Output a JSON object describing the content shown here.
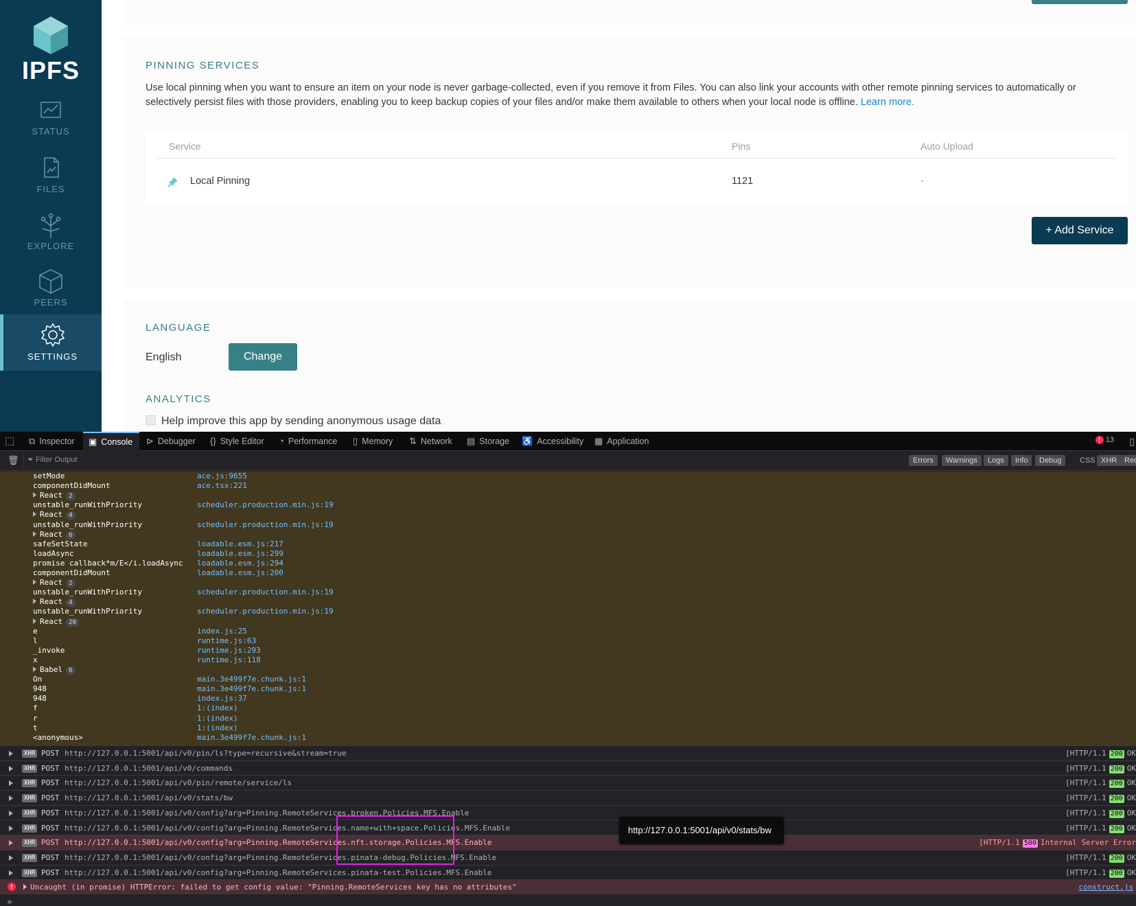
{
  "app": {
    "logo_text": "IPFS",
    "nav": [
      {
        "label": "STATUS",
        "icon": "status-chart-icon"
      },
      {
        "label": "FILES",
        "icon": "files-document-icon"
      },
      {
        "label": "EXPLORE",
        "icon": "explore-tree-icon"
      },
      {
        "label": "PEERS",
        "icon": "peers-cube-icon"
      },
      {
        "label": "SETTINGS",
        "icon": "settings-gear-icon",
        "active": true
      }
    ],
    "pinning": {
      "title": "PINNING SERVICES",
      "description": "Use local pinning when you want to ensure an item on your node is never garbage-collected, even if you remove it from Files. You can also link your accounts with other remote pinning services to automatically or selectively persist files with those providers, enabling you to keep backup copies of your files and/or make them available to others when your local node is offline.",
      "learn_more": "Learn more.",
      "columns": [
        "Service",
        "Pins",
        "Auto Upload"
      ],
      "rows": [
        {
          "service": "Local Pinning",
          "pins": "1121",
          "auto_upload": "-"
        }
      ],
      "add_button": "+ Add Service"
    },
    "language": {
      "title": "LANGUAGE",
      "value": "English",
      "change_button": "Change"
    },
    "analytics": {
      "title": "ANALYTICS",
      "checkbox_label": "Help improve this app by sending anonymous usage data"
    }
  },
  "devtools": {
    "tabs": [
      "Inspector",
      "Console",
      "Debugger",
      "Style Editor",
      "Performance",
      "Memory",
      "Network",
      "Storage",
      "Accessibility",
      "Application"
    ],
    "selected_tab": "Console",
    "error_count": "13",
    "filter_placeholder": "Filter Output",
    "filter_buttons": [
      "Errors",
      "Warnings",
      "Logs",
      "Info",
      "Debug",
      "CSS",
      "XHR",
      "Req"
    ],
    "stack": [
      {
        "fn": "setMode",
        "loc": "ace.js:9655"
      },
      {
        "fn": "componentDidMount",
        "loc": "ace.tsx:221"
      },
      {
        "group": "React",
        "count": "2"
      },
      {
        "fn": "unstable_runWithPriority",
        "loc": "scheduler.production.min.js:19"
      },
      {
        "group": "React",
        "count": "4"
      },
      {
        "fn": "unstable_runWithPriority",
        "loc": "scheduler.production.min.js:19"
      },
      {
        "group": "React",
        "count": "6"
      },
      {
        "fn": "safeSetState",
        "loc": "loadable.esm.js:217"
      },
      {
        "fn": "loadAsync",
        "loc": "loadable.esm.js:299"
      },
      {
        "fn": "promise callback*m/E</i.loadAsync",
        "loc": "loadable.esm.js:294"
      },
      {
        "fn": "componentDidMount",
        "loc": "loadable.esm.js:200"
      },
      {
        "group": "React",
        "count": "2"
      },
      {
        "fn": "unstable_runWithPriority",
        "loc": "scheduler.production.min.js:19"
      },
      {
        "group": "React",
        "count": "4"
      },
      {
        "fn": "unstable_runWithPriority",
        "loc": "scheduler.production.min.js:19"
      },
      {
        "group": "React",
        "count": "20"
      },
      {
        "fn": "e",
        "loc": "index.js:25"
      },
      {
        "fn": "l",
        "loc": "runtime.js:63"
      },
      {
        "fn": "_invoke",
        "loc": "runtime.js:293"
      },
      {
        "fn": "x",
        "loc": "runtime.js:118"
      },
      {
        "group": "Babel",
        "count": "6"
      },
      {
        "fn": "On",
        "loc": "main.3e499f7e.chunk.js:1"
      },
      {
        "fn": "948",
        "loc": "main.3e499f7e.chunk.js:1"
      },
      {
        "fn": "948",
        "loc": "index.js:37"
      },
      {
        "fn": "f",
        "loc": "1:(index)"
      },
      {
        "fn": "r",
        "loc": "1:(index)"
      },
      {
        "fn": "t",
        "loc": "1:(index)"
      },
      {
        "fn": "<anonymous>",
        "loc": "main.3e499f7e.chunk.js:1"
      }
    ],
    "requests": [
      {
        "method": "POST",
        "url": "http://127.0.0.1:5001/api/v0/pin/ls?type=recursive&stream=true",
        "proto": "[HTTP/1.1",
        "code": "200",
        "text": "OK"
      },
      {
        "method": "POST",
        "url": "http://127.0.0.1:5001/api/v0/commands",
        "proto": "[HTTP/1.1",
        "code": "200",
        "text": "OK"
      },
      {
        "method": "POST",
        "url": "http://127.0.0.1:5001/api/v0/pin/remote/service/ls",
        "proto": "[HTTP/1.1",
        "code": "200",
        "text": "OK"
      },
      {
        "method": "POST",
        "url": "http://127.0.0.1:5001/api/v0/stats/bw",
        "proto": "[HTTP/1.1",
        "code": "200",
        "text": "OK"
      },
      {
        "method": "POST",
        "url": "http://127.0.0.1:5001/api/v0/config?arg=Pinning.RemoteServices.broken.Policies.MFS.Enable",
        "proto": "[HTTP/1.1",
        "code": "200",
        "text": "OK"
      },
      {
        "method": "POST",
        "url": "http://127.0.0.1:5001/api/v0/config?arg=Pinning.RemoteServices.name+with+space.Policies.MFS.Enable",
        "proto": "[HTTP/1.1",
        "code": "200",
        "text": "OK"
      },
      {
        "method": "POST",
        "url": "http://127.0.0.1:5001/api/v0/config?arg=Pinning.RemoteServices.nft.storage.Policies.MFS.Enable",
        "proto": "[HTTP/1.1",
        "code": "500",
        "text": "Internal Server Error",
        "error": true
      },
      {
        "method": "POST",
        "url": "http://127.0.0.1:5001/api/v0/config?arg=Pinning.RemoteServices.pinata-debug.Policies.MFS.Enable",
        "proto": "[HTTP/1.1",
        "code": "200",
        "text": "OK"
      },
      {
        "method": "POST",
        "url": "http://127.0.0.1:5001/api/v0/config?arg=Pinning.RemoteServices.pinata-test.Policies.MFS.Enable",
        "proto": "[HTTP/1.1",
        "code": "200",
        "text": "OK"
      }
    ],
    "xhr_tag": "XHR",
    "uncaught_error": "Uncaught (in promise) HTTPError: failed to get config value: \"Pinning.RemoteServices key has no attributes\"",
    "uncaught_source": "construct.js",
    "prompt": "»",
    "tooltip": "http://127.0.0.1:5001/api/v0/stats/bw"
  },
  "colors": {
    "sidebar": "#0b3a53",
    "accent": "#378085",
    "link": "#1c86c7",
    "stack_bg": "#42381f",
    "error_bg": "#4b2f36"
  }
}
